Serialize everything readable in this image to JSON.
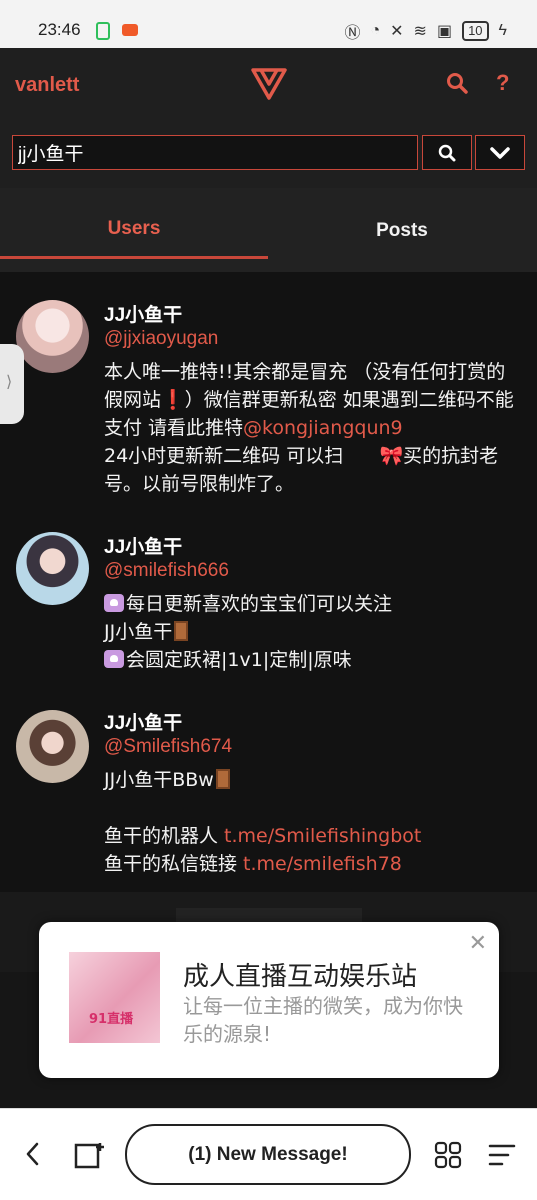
{
  "status_bar": {
    "time": "23:46",
    "battery": "10"
  },
  "topbar": {
    "brand": "vanlett",
    "help_label": "?"
  },
  "search": {
    "value": "jj小鱼干"
  },
  "tabs": [
    {
      "label": "Users"
    },
    {
      "label": "Posts"
    }
  ],
  "users": [
    {
      "name": "JJ小鱼干",
      "handle": "@jjxiaoyugan",
      "bio_part1": "本人唯一推特!!其余都是冒充 （没有任何打赏的假网站",
      "bio_mark": "❗",
      "bio_part2": "）微信群更新私密 如果遇到二维码不能支付 请看此推特",
      "bio_link": "@kongjiangqun9",
      "bio_part3": "24小时更新新二维码 可以扫",
      "bio_bow": "🎀",
      "bio_part4": "买的抗封老号。以前号限制炸了。"
    },
    {
      "name": "JJ小鱼干",
      "handle": "@smilefish666",
      "bio_line1": "每日更新喜欢的宝宝们可以关注",
      "bio_line2": "JJ小鱼干",
      "bio_line3": "会圆定跃裙|1v1|定制|原味"
    },
    {
      "name": "JJ小鱼干",
      "handle": "@Smilefish674",
      "bio_line1": "JJ小鱼干BBw",
      "bio_line2_text": "鱼干的机器人 ",
      "bio_line2_link": "t.me/Smilefishingbot",
      "bio_line3_text": "鱼干的私信链接 ",
      "bio_line3_link": "t.me/smilefish78"
    }
  ],
  "ad": {
    "title": "成人直播互动娱乐站",
    "description": "让每一位主播的微笑，成为你快乐的源泉!",
    "image_label": "91直播"
  },
  "navbar": {
    "message_label": "(1) New Message!"
  },
  "colors": {
    "accent": "#e15a4a",
    "background": "#121212",
    "tab_active": "#e8604f"
  },
  "icons": [
    "search-icon",
    "help-icon",
    "chevron-down-icon",
    "back-icon",
    "tabs-icon",
    "apps-icon",
    "menu-icon",
    "close-icon"
  ]
}
